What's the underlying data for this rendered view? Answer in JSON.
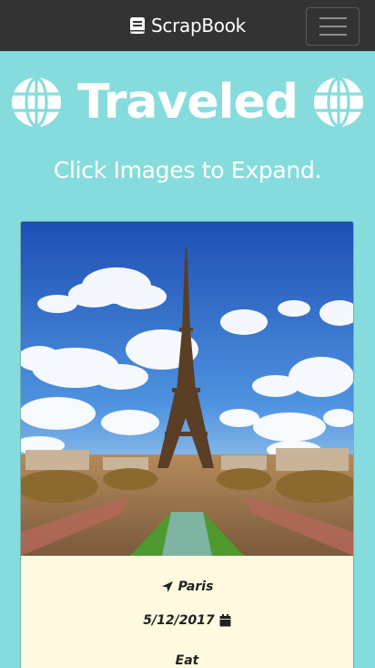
{
  "navbar": {
    "brand_icon": "book-icon",
    "brand": "ScrapBook",
    "toggle_icon": "hamburger-icon"
  },
  "header": {
    "icon": "globe-icon",
    "title": "Traveled"
  },
  "subtitle": "Click Images to Expand.",
  "card": {
    "image_subject": "Eiffel Tower under blue sky",
    "location_icon": "location-arrow-icon",
    "location": "Paris",
    "date": "5/12/2017",
    "date_icon": "calendar-icon",
    "category": "Eat"
  },
  "colors": {
    "navbar": "#333333",
    "page_bg": "#86dcdc",
    "card_body": "#fffadf",
    "text_light": "#ffffff"
  }
}
